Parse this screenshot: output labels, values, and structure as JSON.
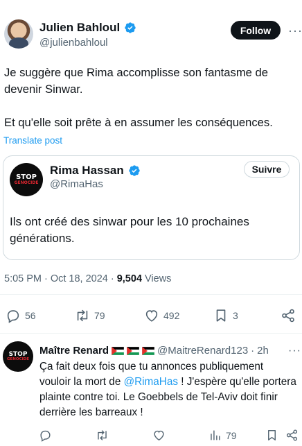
{
  "post": {
    "author_name": "Julien Bahloul",
    "author_handle": "@julienbahloul",
    "follow_label": "Follow",
    "text": "Je suggère que Rima accomplisse son fantasme de devenir Sinwar.\n\nEt qu'elle soit prête à en assumer les conséquences.",
    "translate_label": "Translate post",
    "time": "5:05 PM",
    "date": "Oct 18, 2024",
    "views_count": "9,504",
    "views_label": "Views",
    "replies": "56",
    "reposts": "79",
    "likes": "492",
    "bookmarks": "3"
  },
  "quote": {
    "author_name": "Rima Hassan",
    "author_handle": "@RimaHas",
    "follow_label": "Suivre",
    "text": "Ils ont créé des sinwar pour les 10 prochaines générations.",
    "avatar_text_top": "STOP",
    "avatar_text_bottom": "GENOCIDE"
  },
  "reply": {
    "author_name": "Maître Renard",
    "author_handle": "@MaitreRenard123",
    "separator": "·",
    "time": "2h",
    "text_before": "Ça fait deux fois que tu annonces publiquement vouloir la mort de ",
    "mention": "@RimaHas",
    "text_after": " ! J'espère qu'elle portera plainte contre toi. Le Goebbels de Tel-Aviv doit finir derrière les barreaux !",
    "views": "79",
    "avatar_text_top": "STOP",
    "avatar_text_bottom": "GENOCIDE"
  },
  "colors": {
    "accent": "#1d9bf0",
    "text": "#0f1419",
    "muted": "#536471",
    "border": "#cfd9de",
    "stop_red": "#e0262f"
  },
  "icons": [
    "verified-badge-icon",
    "more-options-icon",
    "reply-icon",
    "retweet-icon",
    "like-icon",
    "bookmark-icon",
    "share-icon",
    "views-icon",
    "palestine-flag-icon"
  ]
}
